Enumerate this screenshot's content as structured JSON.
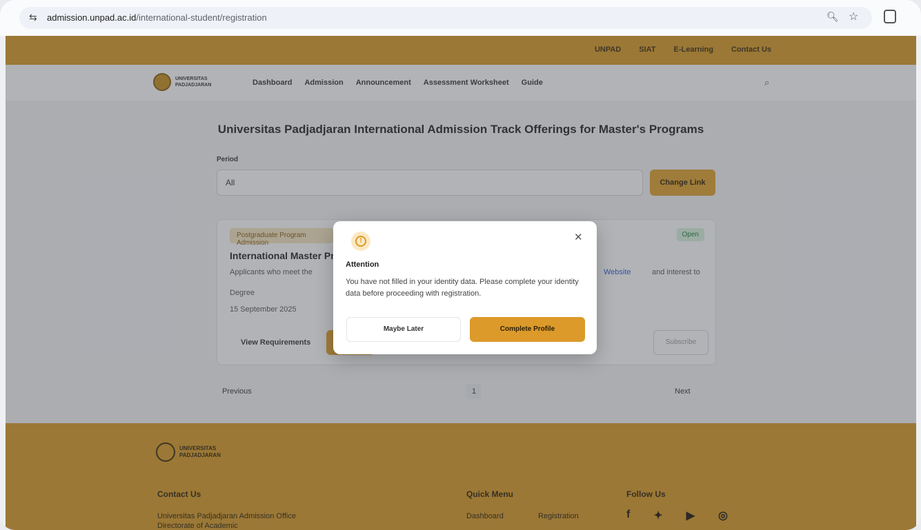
{
  "browser": {
    "url_domain": "admission.unpad.ac.id",
    "url_path": "/international-student/registration"
  },
  "topbar": {
    "links": [
      "UNPAD",
      "SIAT",
      "E-Learning",
      "Contact Us"
    ]
  },
  "nav": {
    "logo_line1": "UNIVERSITAS",
    "logo_line2": "PADJADJARAN",
    "links": [
      "Dashboard",
      "Admission",
      "Announcement",
      "Assessment Worksheet",
      "Guide"
    ]
  },
  "main": {
    "headline": "Universitas Padjadjaran International Admission Track Offerings for Master's Programs",
    "period_label": "Period",
    "period_value": "All",
    "change_button": "Change Link"
  },
  "card": {
    "badge": "Postgraduate Program Admission",
    "status": "Open",
    "title": "International Master Pr",
    "desc": "Applicants who meet the",
    "link": "Website",
    "link_tail": "and interest to",
    "meta1": "Degree",
    "meta2": "15 September 2025",
    "view_requirements": "View Requirements",
    "subscribe": "Subscribe"
  },
  "pager": {
    "prev": "Previous",
    "page": "1",
    "next": "Next"
  },
  "footer": {
    "logo_line1": "UNIVERSITAS",
    "logo_line2": "PADJADJARAN",
    "contact_heading": "Contact Us",
    "contact_line1": "Universitas Padjadjaran Admission Office",
    "contact_line2": "Directorate of Academic",
    "quick_heading": "Quick Menu",
    "quick_links": [
      "Dashboard",
      "Registration"
    ],
    "follow_heading": "Follow Us",
    "social_icons": [
      "facebook-icon",
      "twitter-icon",
      "youtube-icon",
      "instagram-icon"
    ]
  },
  "modal": {
    "title": "Attention",
    "body": "You have not filled in your identity data. Please complete your identity data before proceeding with registration.",
    "later_button": "Maybe Later",
    "complete_button": "Complete Profile"
  },
  "colors": {
    "brand": "#d99a24",
    "accent_button": "#dc9a2a"
  }
}
